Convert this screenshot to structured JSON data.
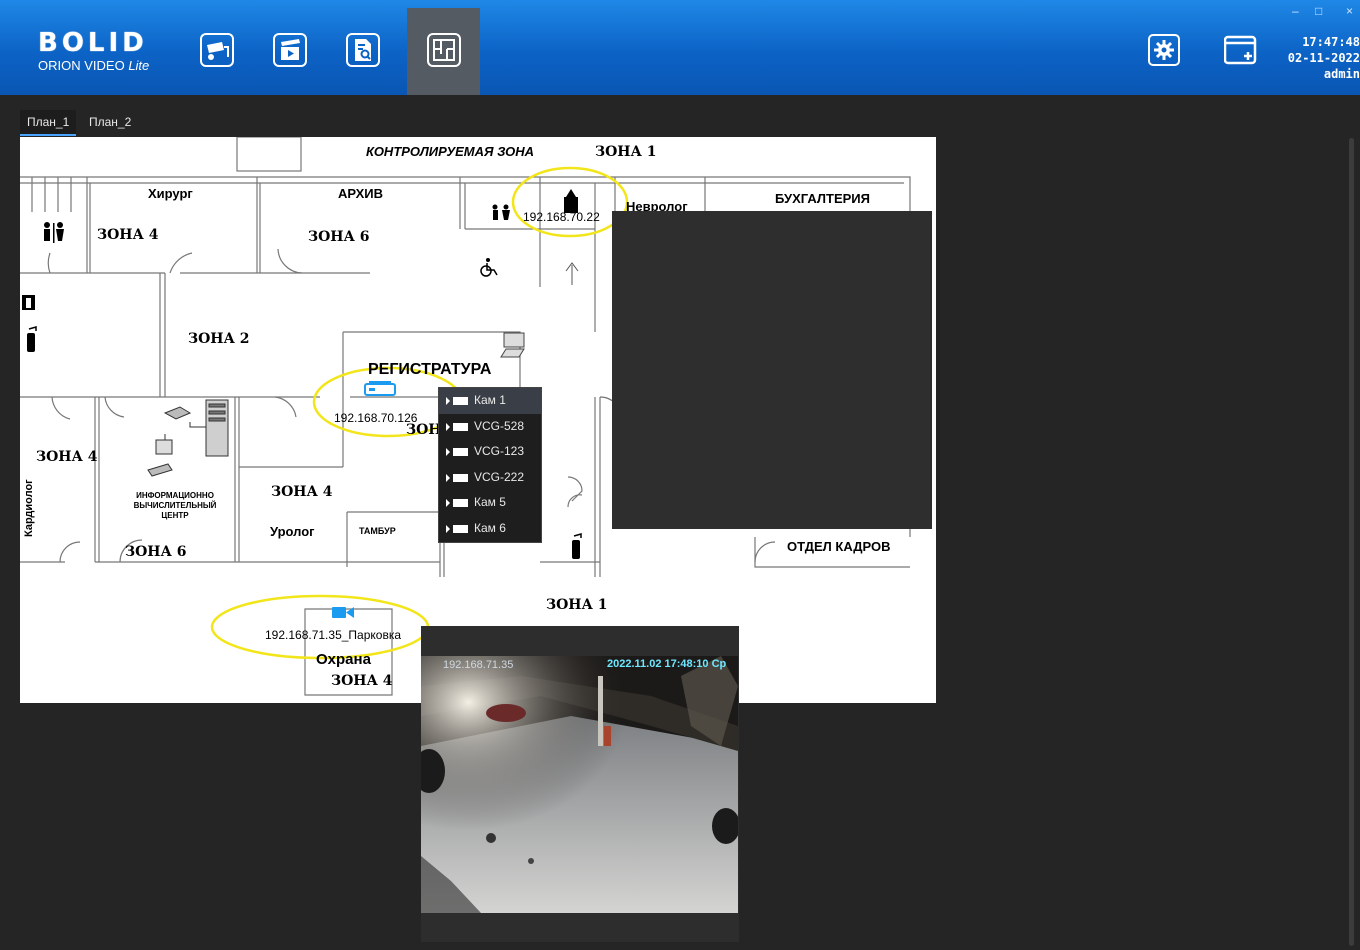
{
  "topbar": {
    "logo_word": "BOLID",
    "logo_product": "ORION VIDEO",
    "logo_edition": "Lite",
    "nav": [
      {
        "name": "cameras",
        "icon": "cctv-icon"
      },
      {
        "name": "archive",
        "icon": "clapperboard-icon"
      },
      {
        "name": "search",
        "icon": "document-search-icon"
      },
      {
        "name": "plans",
        "icon": "floor-plan-icon",
        "active": true
      }
    ],
    "settings_icon": "gear-icon",
    "add_window_icon": "add-window-icon",
    "window_controls": {
      "minimize": "–",
      "maximize": "□",
      "close": "×"
    },
    "time": "17:47:48",
    "date": "02-11-2022",
    "user": "admin"
  },
  "tabs": [
    {
      "label": "План_1",
      "active": true
    },
    {
      "label": "План_2",
      "active": false
    }
  ],
  "plan": {
    "title": "КОНТРОЛИРУЕМАЯ ЗОНА",
    "zones": {
      "z1_top": "ЗОНА 1",
      "z4_left": "ЗОНА 4",
      "z6_top": "ЗОНА 6",
      "z2": "ЗОНА 2",
      "z4_mid": "ЗОНА 4",
      "z4_lower": "ЗОНА 4",
      "z6_bottom": "ЗОНА 6",
      "z1_bottom": "ЗОНА 1",
      "z4_guard": "ЗОНА 4",
      "z_partial": "ЗОН"
    },
    "rooms": {
      "surgeon": "Хирург",
      "archive": "АРХИВ",
      "neurologist": "Невролог",
      "accounting": "БУХГАЛТЕРИЯ",
      "registry": "РЕГИСТРАТУРА",
      "cardiologist": "Кардиолог",
      "it_center_1": "ИНФОРМАЦИОННО",
      "it_center_2": "ВЫЧИСЛИТЕЛЬНЫЙ",
      "it_center_3": "ЦЕНТР",
      "urologist": "Уролог",
      "vestibule": "ТАМБУР",
      "hr": "ОТДЕЛ КАДРОВ",
      "security": "Охрана"
    },
    "devices": [
      {
        "ip": "192.168.70.22",
        "icon": "camera-device-icon"
      },
      {
        "ip": "192.168.70.126",
        "icon": "video-recorder-icon"
      },
      {
        "ip": "192.168.71.35_Парковка",
        "icon": "video-camera-icon"
      }
    ]
  },
  "camera_menu": [
    {
      "label": "Кам 1",
      "selected": true
    },
    {
      "label": "VCG-528"
    },
    {
      "label": "VCG-123"
    },
    {
      "label": "VCG-222"
    },
    {
      "label": "Кам 5"
    },
    {
      "label": "Кам 6"
    }
  ],
  "video": {
    "ip": "192.168.71.35",
    "timestamp": "2022.11.02 17:48:10 Ср"
  },
  "colors": {
    "accent": "#0c63c6",
    "highlight_ring": "#f2e51a",
    "camera_blue": "#1a9bf0"
  }
}
